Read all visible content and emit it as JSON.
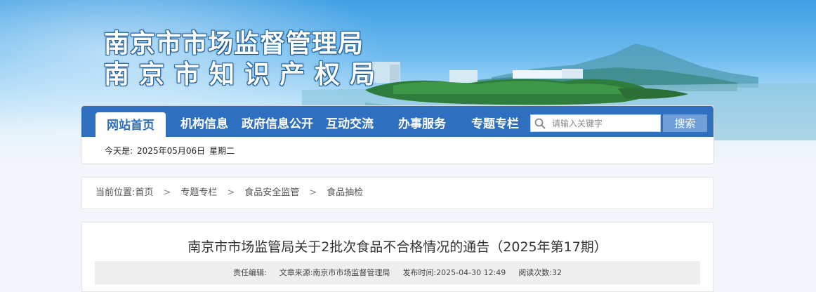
{
  "header": {
    "title_line1": "南京市市场监督管理局",
    "title_line2": "南京市知识产权局"
  },
  "nav": {
    "items": [
      {
        "label": "网站首页",
        "active": true
      },
      {
        "label": "机构信息",
        "active": false
      },
      {
        "label": "政府信息公开",
        "active": false
      },
      {
        "label": "互动交流",
        "active": false
      },
      {
        "label": "办事服务",
        "active": false
      },
      {
        "label": "专题专栏",
        "active": false
      }
    ],
    "search": {
      "placeholder": "请输入关键字",
      "button_label": "搜索",
      "icon": "search-icon"
    }
  },
  "date_bar": {
    "prefix": "今天是:",
    "date": "2025年05月06日",
    "weekday": "星期二"
  },
  "breadcrumb": {
    "label": "当前位置:",
    "items": [
      "首页",
      "专题专栏",
      "食品安全监管",
      "食品抽检"
    ]
  },
  "article": {
    "title": "南京市市场监管局关于2批次食品不合格情况的通告（2025年第17期）",
    "meta": {
      "editor": "责任编辑:",
      "source": "文章来源:南京市市场监督管理局",
      "published": "发布时间:2025-04-30 12:49",
      "views": "阅读次数:32"
    }
  },
  "colors": {
    "nav_blue": "#2f6fbf",
    "search_button": "#6f9fd6",
    "meta_bg": "#eeeeee"
  }
}
